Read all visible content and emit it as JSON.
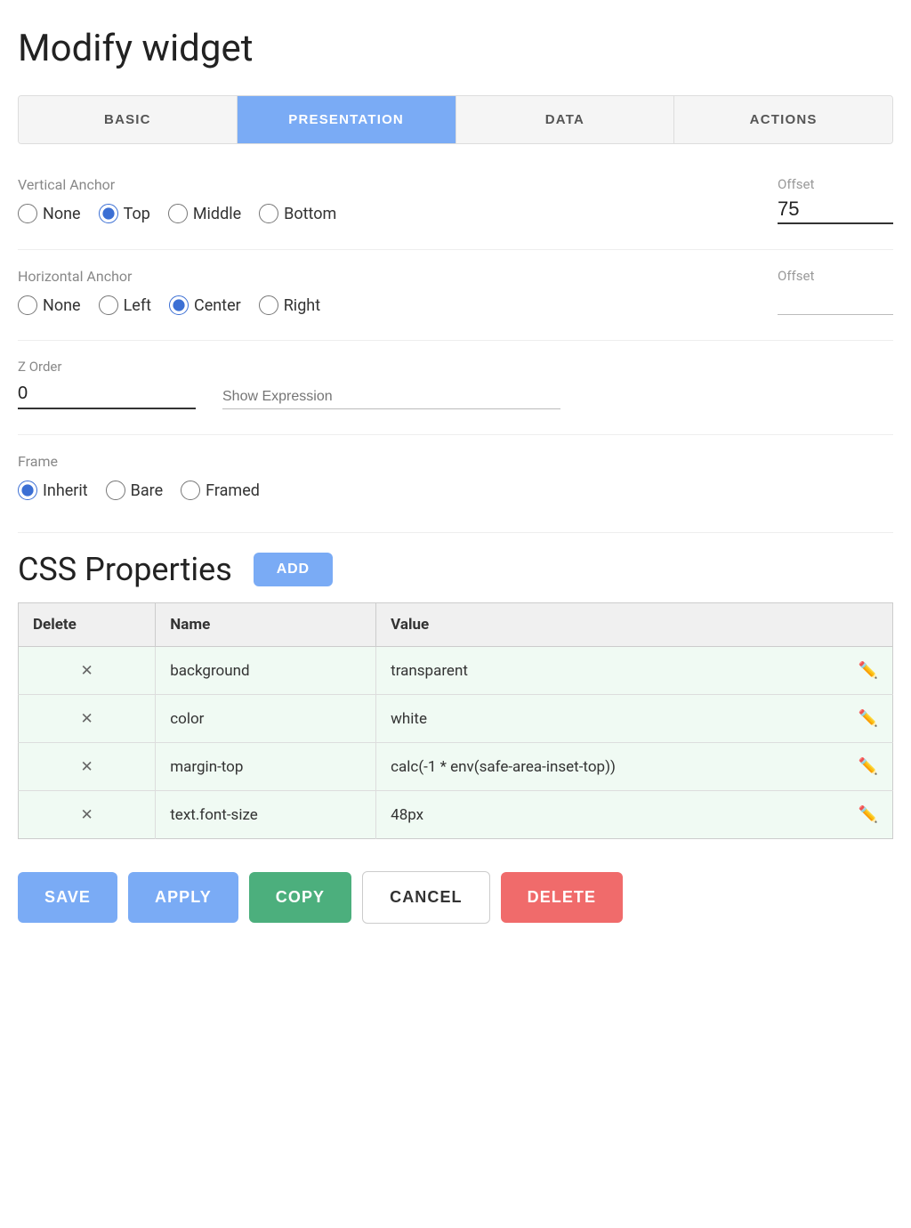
{
  "page": {
    "title": "Modify widget"
  },
  "tabs": {
    "items": [
      {
        "id": "basic",
        "label": "BASIC",
        "active": false
      },
      {
        "id": "presentation",
        "label": "PRESENTATION",
        "active": true
      },
      {
        "id": "data",
        "label": "DATA",
        "active": false
      },
      {
        "id": "actions",
        "label": "ACTIONS",
        "active": false
      }
    ]
  },
  "vertical_anchor": {
    "label": "Vertical Anchor",
    "options": [
      "None",
      "Top",
      "Middle",
      "Bottom"
    ],
    "selected": "Top",
    "offset_label": "Offset",
    "offset_value": "75"
  },
  "horizontal_anchor": {
    "label": "Horizontal Anchor",
    "options": [
      "None",
      "Left",
      "Center",
      "Right"
    ],
    "selected": "Center",
    "offset_label": "Offset",
    "offset_value": ""
  },
  "z_order": {
    "label": "Z Order",
    "value": "0"
  },
  "show_expression": {
    "placeholder": "Show Expression",
    "value": ""
  },
  "frame": {
    "label": "Frame",
    "options": [
      "Inherit",
      "Bare",
      "Framed"
    ],
    "selected": "Inherit"
  },
  "css_properties": {
    "title": "CSS Properties",
    "add_label": "ADD",
    "table": {
      "headers": [
        "Delete",
        "Name",
        "Value"
      ],
      "rows": [
        {
          "name": "background",
          "value": "transparent"
        },
        {
          "name": "color",
          "value": "white"
        },
        {
          "name": "margin-top",
          "value": "calc(-1 * env(safe-area-inset-top))"
        },
        {
          "name": "text.font-size",
          "value": "48px"
        }
      ]
    }
  },
  "buttons": {
    "save": "SAVE",
    "apply": "APPLY",
    "copy": "COPY",
    "cancel": "CANCEL",
    "delete": "DELETE"
  }
}
